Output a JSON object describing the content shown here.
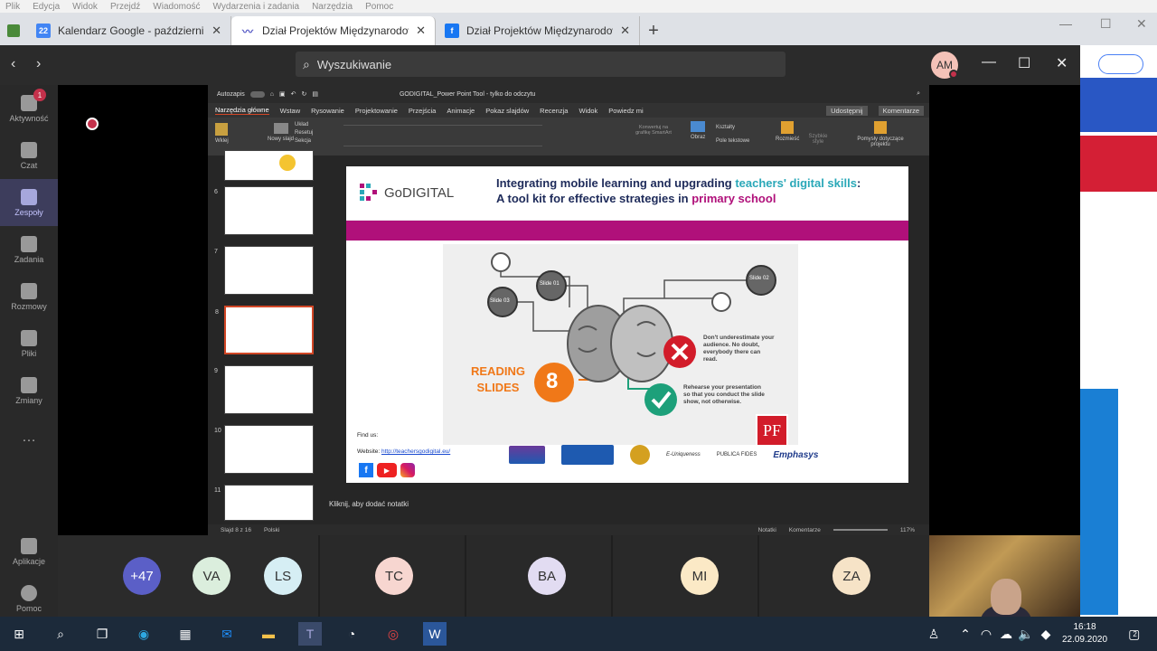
{
  "browser_menu": [
    "Plik",
    "Edycja",
    "Widok",
    "Przejdź",
    "Wiadomość",
    "Wydarzenia i zadania",
    "Narzędzia",
    "Pomoc"
  ],
  "browser_tabs": [
    {
      "title": "Kalendarz Google - październik 2",
      "close": "✕",
      "favicon": "22"
    },
    {
      "title": "Dział Projektów Międzynarodow",
      "close": "✕",
      "favicon": ""
    },
    {
      "title": "Dział Projektów Międzynarodow",
      "close": "✕",
      "favicon": "f"
    }
  ],
  "new_tab": "+",
  "teams": {
    "search_placeholder": "Wyszukiwanie",
    "user_initials": "AM",
    "rail": [
      {
        "label": "Aktywność",
        "badge": "1"
      },
      {
        "label": "Czat"
      },
      {
        "label": "Zespoły"
      },
      {
        "label": "Zadania"
      },
      {
        "label": "Rozmowy"
      },
      {
        "label": "Pliki"
      },
      {
        "label": "Zmiany"
      },
      {
        "label": "…"
      },
      {
        "label": "Aplikacje"
      },
      {
        "label": "Pomoc"
      }
    ],
    "gallery": [
      {
        "initials": "+47",
        "color": "#5b5fc7",
        "text": "#ffffff"
      },
      {
        "initials": "VA",
        "color": "#dbeedd",
        "text": "#333333"
      },
      {
        "initials": "LS",
        "color": "#d6eef4",
        "text": "#333333"
      },
      {
        "initials": "TC",
        "color": "#f7d6d0",
        "text": "#333333"
      },
      {
        "initials": "BA",
        "color": "#e2dcf2",
        "text": "#333333"
      },
      {
        "initials": "MI",
        "color": "#fbe9c6",
        "text": "#333333"
      },
      {
        "initials": "ZA",
        "color": "#f6e3c7",
        "text": "#333333"
      }
    ]
  },
  "ppt": {
    "autosave": "Autozapis",
    "title": "GODIGITAL_Power Point Tool  -  tylko do odczytu",
    "tabs": [
      "Narzędzia główne",
      "Wstaw",
      "Rysowanie",
      "Projektowanie",
      "Przejścia",
      "Animacje",
      "Pokaz slajdów",
      "Recenzja",
      "Widok",
      "Powiedz mi"
    ],
    "share": "Udostępnij",
    "comments": "Komentarze",
    "ribbon": [
      "Wklej",
      "Nowy slajd",
      "Układ",
      "Resetuj",
      "Sekcja",
      "Obraz",
      "Kształty",
      "Pole tekstowe",
      "Rozmieść",
      "Szybkie style",
      "Pomysły dotyczące projektu",
      "Konwertuj na grafikę SmartArt"
    ],
    "thumb_numbers": [
      "6",
      "7",
      "8",
      "9",
      "10",
      "11"
    ],
    "slide": {
      "logo": "GoDIGITAL",
      "heading_1": "Integrating mobile learning and upgrading ",
      "heading_highlight": "teachers' digital skills",
      "heading_2": ":",
      "heading_3": "A tool kit for effective strategies in ",
      "heading_highlight2": "primary school",
      "node_slide01": "Slide 01",
      "node_slide02": "Slide 02",
      "node_slide03": "Slide 03",
      "reading": "READING",
      "slides": "SLIDES",
      "number": "8",
      "dont": "Don't underestimate your audience. No doubt, everybody there can read.",
      "rehearse": "Rehearse your presentation so that you conduct the slide show, not otherwise.",
      "find_us": "Find us:",
      "website_label": "Website:",
      "website_url": "http://teachersgodigital.eu/",
      "partner_emphasys": "Emphasys",
      "partner_publica": "PUBLICA FIDES",
      "partner_uniqueness": "E-Uniqueness",
      "pf": "PF"
    },
    "notes": "Kliknij, aby dodać notatki",
    "status": {
      "slide": "Slajd 8 z 16",
      "lang": "Polski",
      "notes": "Notatki",
      "comments": "Komentarze",
      "zoom": "117%"
    }
  },
  "clock": {
    "time": "16:18",
    "date": "22.09.2020"
  },
  "taskbar_notif": "2"
}
